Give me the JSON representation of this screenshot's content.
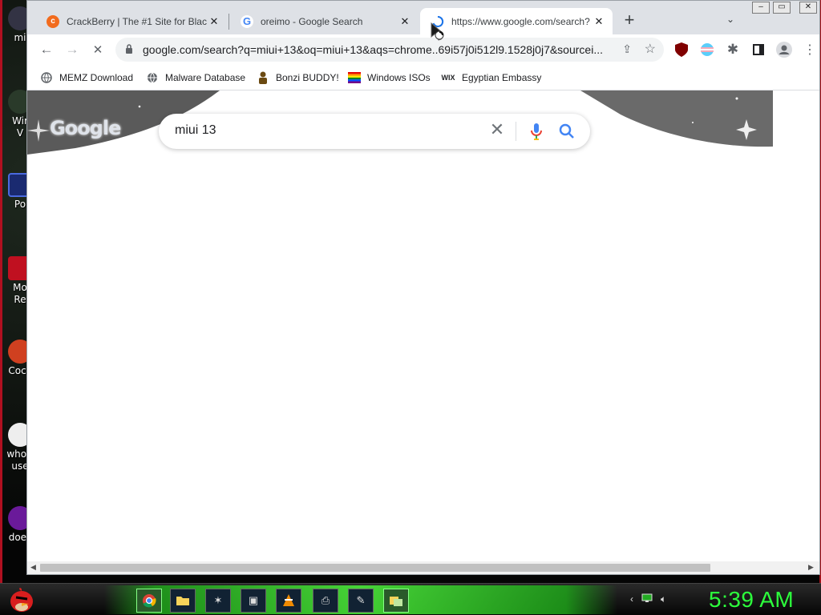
{
  "desktop": {
    "icons": [
      {
        "label": "mi"
      },
      {
        "label": "Wir\nV"
      },
      {
        "label": "Po"
      },
      {
        "label": "Mo\nRe"
      },
      {
        "label": "Cock"
      },
      {
        "label": "who t\nuse"
      },
      {
        "label": "does"
      }
    ]
  },
  "browser": {
    "tabs": [
      {
        "title": "CrackBerry | The #1 Site for Blac",
        "favicon": "CB",
        "color": "#f26b1d"
      },
      {
        "title": "oreimo - Google Search",
        "favicon": "G",
        "color": "#4285f4"
      },
      {
        "title": "https://www.google.com/search?",
        "favicon": "loading",
        "color": "#1a73e8"
      }
    ],
    "new_tab_label": "+",
    "tab_search_label": "⌄",
    "toolbar": {
      "back_icon": "←",
      "forward_icon": "→",
      "reload_icon": "✕",
      "url": "google.com/search?q=miui+13&oq=miui+13&aqs=chrome..69i57j0i512l9.1528j0j7&sourcei..."
    },
    "bookmarks": [
      {
        "label": "MEMZ Download",
        "icon": "globe"
      },
      {
        "label": "Malware Database",
        "icon": "globe"
      },
      {
        "label": "Bonzi BUDDY!",
        "icon": "bonzi"
      },
      {
        "label": "Windows ISOs",
        "icon": "rainbow"
      },
      {
        "label": "Egyptian Embassy",
        "icon": "WIX"
      }
    ],
    "page": {
      "logo_text": "Google",
      "search_query": "miui 13"
    }
  },
  "taskbar": {
    "clock": "5:39 AM",
    "apps": [
      "chrome",
      "folder",
      "spider",
      "terminal",
      "vlc",
      "printer",
      "paint",
      "explorer"
    ]
  }
}
